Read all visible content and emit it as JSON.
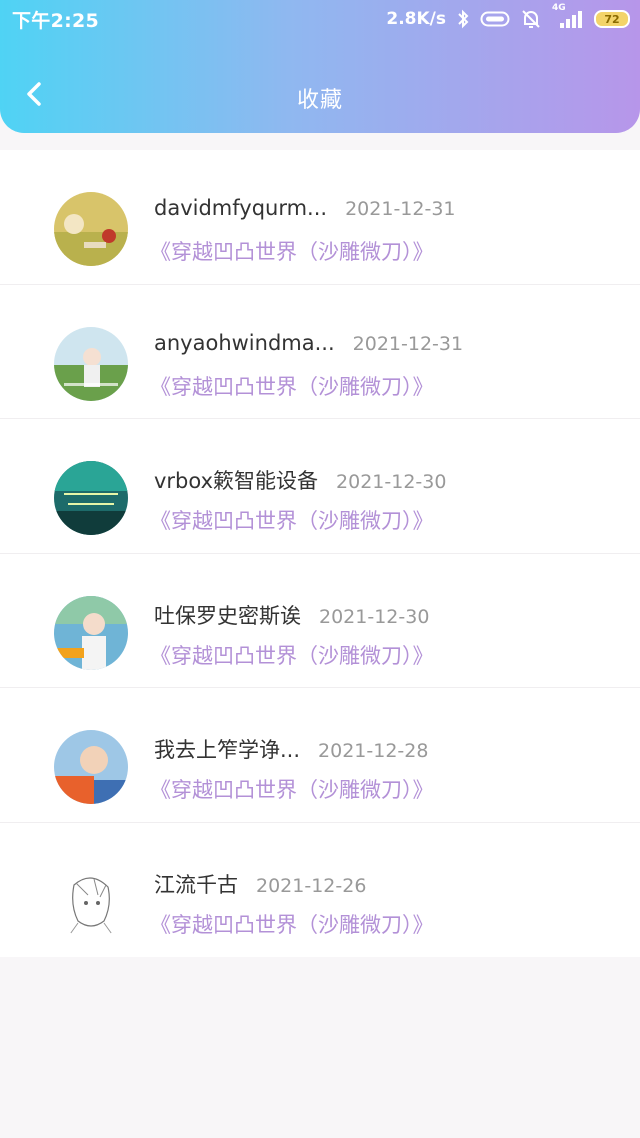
{
  "status_bar": {
    "time": "下午2:25",
    "net_speed": "2.8K/s",
    "battery": "72",
    "signal_label": "4G"
  },
  "nav": {
    "title": "收藏"
  },
  "favorites": [
    {
      "name": "davidmfyqurm...",
      "date": "2021-12-31",
      "work": "《穿越凹凸世界（沙雕微刀）》"
    },
    {
      "name": "anyaohwindma...",
      "date": "2021-12-31",
      "work": "《穿越凹凸世界（沙雕微刀）》"
    },
    {
      "name": "vrbox簌智能设备",
      "date": "2021-12-30",
      "work": "《穿越凹凸世界（沙雕微刀）》"
    },
    {
      "name": "吐保罗史密斯诶",
      "date": "2021-12-30",
      "work": "《穿越凹凸世界（沙雕微刀）》"
    },
    {
      "name": "我去上笮学诤...",
      "date": "2021-12-28",
      "work": "《穿越凹凸世界（沙雕微刀）》"
    },
    {
      "name": "江流千古",
      "date": "2021-12-26",
      "work": "《穿越凹凸世界（沙雕微刀）》"
    }
  ],
  "colors": {
    "header_gradient_start": "#4fd3f4",
    "header_gradient_end": "#b796ea",
    "work_title": "#b391d7",
    "date_text": "#999999"
  }
}
